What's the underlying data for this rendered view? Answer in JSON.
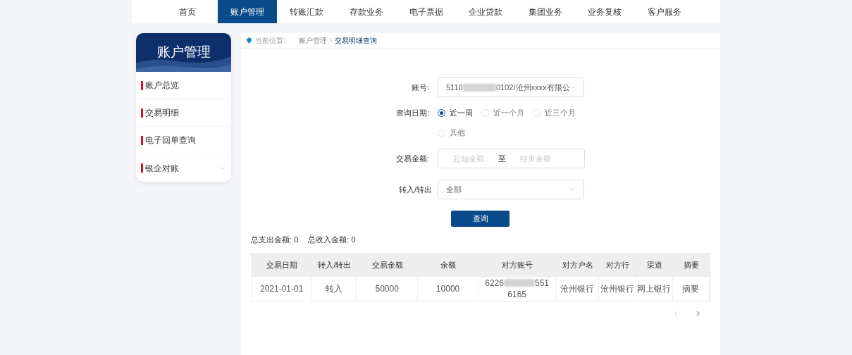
{
  "nav": [
    {
      "label": "首页",
      "selected": false
    },
    {
      "label": "账户管理",
      "selected": true
    },
    {
      "label": "转账汇款",
      "selected": false
    },
    {
      "label": "存款业务",
      "selected": false
    },
    {
      "label": "电子票据",
      "selected": false
    },
    {
      "label": "企业贷款",
      "selected": false
    },
    {
      "label": "集团业务",
      "selected": false
    },
    {
      "label": "业务复核",
      "selected": false
    },
    {
      "label": "客户服务",
      "selected": false
    }
  ],
  "sidebar": {
    "title": "账户管理",
    "items": [
      {
        "label": "账户总览",
        "kind": "link"
      },
      {
        "label": "交易明细",
        "kind": "link"
      },
      {
        "label": "电子回单查询",
        "kind": "link"
      },
      {
        "label": "银企对账",
        "kind": "group"
      }
    ]
  },
  "breadcrumb": {
    "label": "当前位置:",
    "items": [
      "账户管理",
      "交易明细查询"
    ]
  },
  "form": {
    "account": {
      "label": "账号:",
      "before": "5110",
      "after": "0102/沧州xxxx有限公"
    },
    "date": {
      "label": "查询日期:",
      "options": [
        {
          "label": "近一周",
          "selected": true
        },
        {
          "label": "近一个月",
          "selected": false
        },
        {
          "label": "近三个月",
          "selected": false
        },
        {
          "label": "其他",
          "selected": false
        }
      ]
    },
    "amount": {
      "label": "交易金额:",
      "from_placeholder": "起始金额",
      "separator": "至",
      "to_placeholder": "结束金额"
    },
    "direction": {
      "label": "转入/转出",
      "value": "全部"
    },
    "submit": "查询"
  },
  "summary": [
    {
      "label": "总支出金额:",
      "value": "0"
    },
    {
      "label": "总收入金额:",
      "value": "0"
    }
  ],
  "table": {
    "columns": [
      "交易日期",
      "转入/转出",
      "交易金额",
      "余额",
      "对方账号",
      "对方户名",
      "对方行",
      "渠道",
      "摘要"
    ],
    "rows": [
      [
        {
          "kind": "text",
          "text": "2021-01-01"
        },
        {
          "kind": "text",
          "text": "转入"
        },
        {
          "kind": "text",
          "text": "50000"
        },
        {
          "kind": "text",
          "text": "10000"
        },
        {
          "kind": "redacted",
          "before": "6226",
          "after": "551",
          "line2": "6165"
        },
        {
          "kind": "text",
          "text": "沧州银行"
        },
        {
          "kind": "text",
          "text": "沧州银行"
        },
        {
          "kind": "text",
          "text": "网上银行"
        },
        {
          "kind": "text",
          "text": "摘要"
        }
      ]
    ]
  },
  "pagination": [
    {
      "kind": "prev",
      "disabled": true
    },
    {
      "kind": "next",
      "disabled": false
    }
  ]
}
